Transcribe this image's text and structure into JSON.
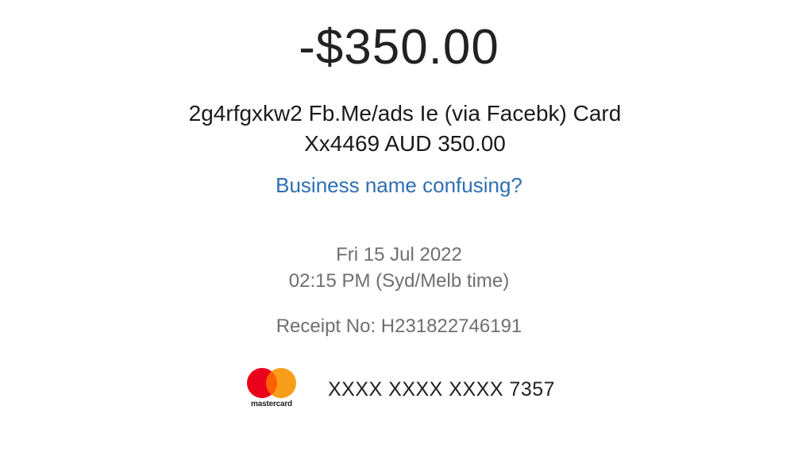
{
  "transaction": {
    "amount": "-$350.00",
    "description_line1": "2g4rfgxkw2 Fb.Me/ads Ie (via Facebk) Card",
    "description_line2": "Xx4469 AUD 350.00",
    "help_link": "Business name confusing?",
    "date": "Fri 15 Jul 2022",
    "time": "02:15 PM (Syd/Melb time)",
    "receipt": "Receipt No: H231822746191"
  },
  "card": {
    "brand_word": "mastercard",
    "brand_icon": "mastercard-logo-icon",
    "number": "XXXX XXXX XXXX 7357",
    "colors": {
      "red": "#EB001B",
      "orange": "#F79E1B",
      "overlap": "#FF5F00"
    }
  },
  "colors": {
    "link": "#2f6fb2",
    "secondary_text": "#6f6f6f",
    "primary_text": "#222222"
  }
}
